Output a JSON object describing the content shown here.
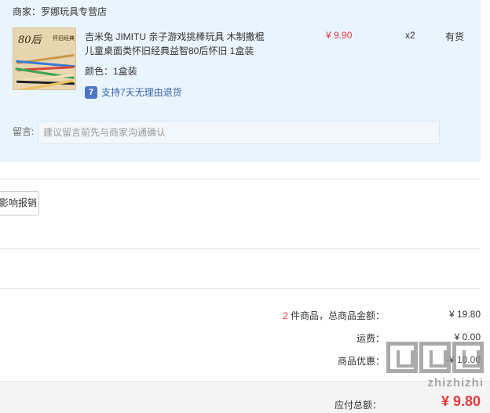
{
  "shop": {
    "label": "商家：罗娜玩具专营店"
  },
  "product": {
    "title": "吉米兔 JIMITU 亲子游戏挑棒玩具 木制撒棍儿童桌面类怀旧经典益智80后怀旧 1盒装",
    "price": "¥ 9.90",
    "quantity": "x2",
    "stock": "有货",
    "spec": "颜色：1盒装",
    "return_policy": "支持7天无理由退货",
    "return_icon_glyph": "7",
    "thumb_tag": "80后",
    "thumb_tag2": "怀旧经典"
  },
  "message": {
    "label": "留言:",
    "placeholder": "建议留言前先与商家沟通确认"
  },
  "invoice": {
    "button_label": "影响报销"
  },
  "summary": {
    "items_count": "2",
    "items_label_suffix": " 件商品，总商品金额：",
    "items_total": "¥ 19.80",
    "shipping_label": "运费：",
    "shipping_value": "¥ 0.00",
    "discount_label": "商品优惠：",
    "discount_value": "-¥ 10.00"
  },
  "total": {
    "label": "应付总额：",
    "amount": "¥ 9.80"
  },
  "watermark": {
    "text": "zhizhizhi"
  },
  "colors": {
    "price_red": "#e4393c",
    "panel_bg": "#eaf4fd",
    "link_blue": "#3b66a8"
  }
}
